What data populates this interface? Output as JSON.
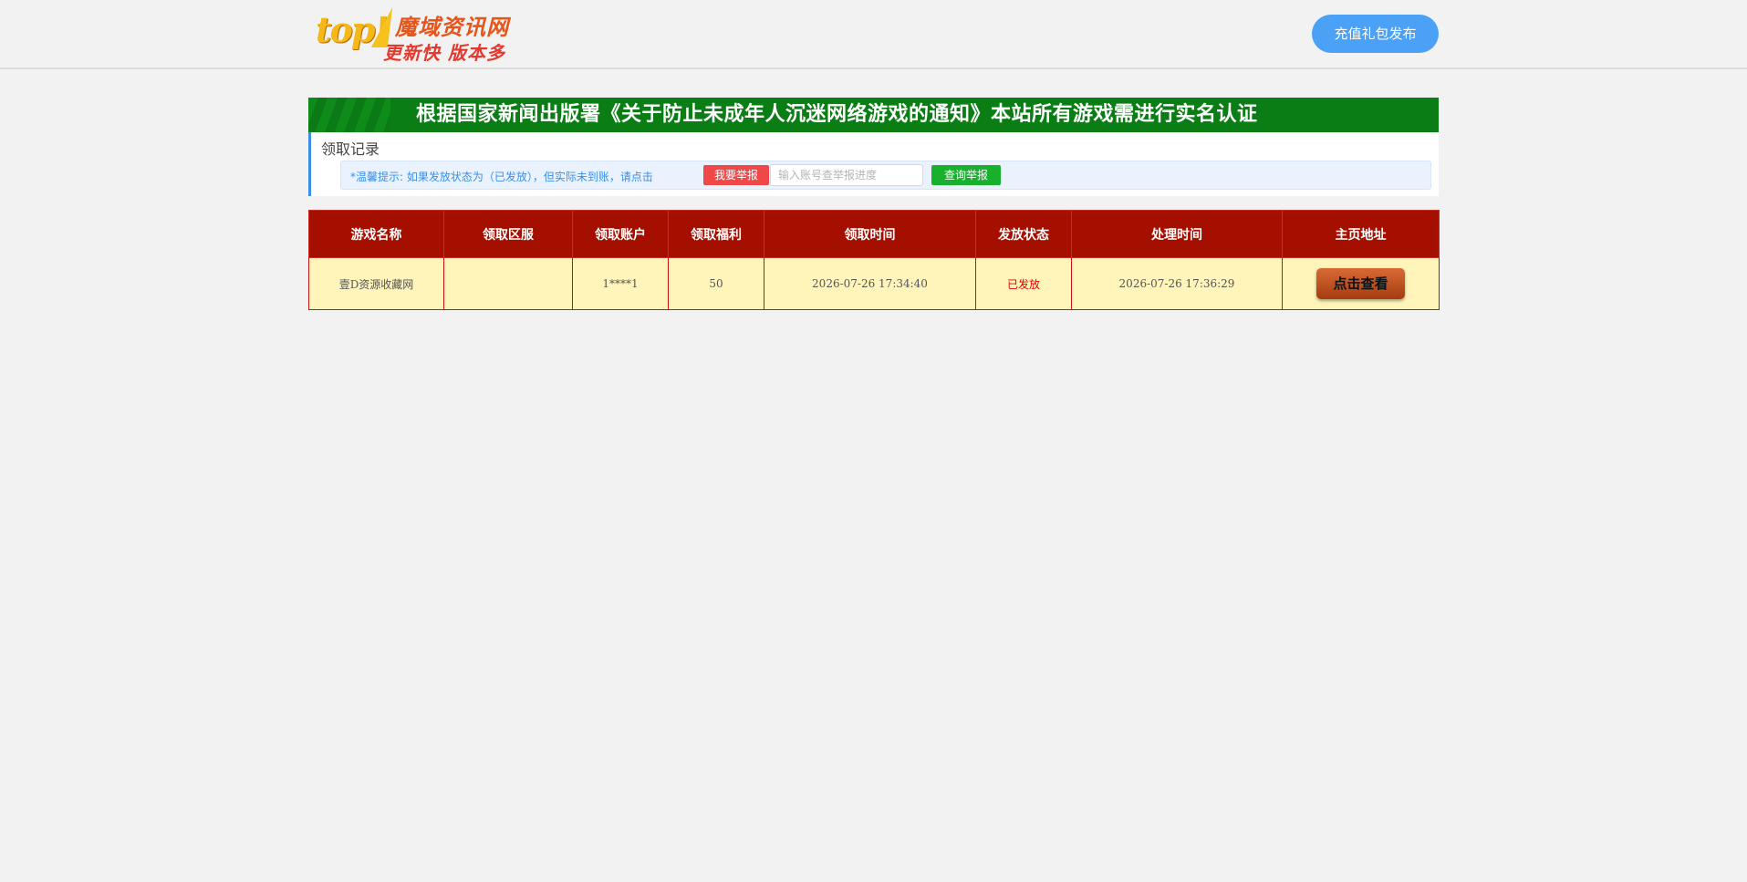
{
  "header": {
    "logo": {
      "top_text": "top!",
      "site_name": "魔域资讯网",
      "slogan": "更新快 版本多"
    },
    "publish_button": "充值礼包发布"
  },
  "notice": {
    "text": "根据国家新闻出版署《关于防止未成年人沉迷网络游戏的通知》本站所有游戏需进行实名认证"
  },
  "records": {
    "title": "领取记录",
    "tip": "*温馨提示: 如果发放状态为（已发放），但实际未到账，请点击",
    "report_button": "我要举报",
    "search_placeholder": "输入账号查举报进度",
    "query_button": "查询举报"
  },
  "table": {
    "headers": [
      "游戏名称",
      "领取区服",
      "领取账户",
      "领取福利",
      "领取时间",
      "发放状态",
      "处理时间",
      "主页地址"
    ],
    "rows": [
      {
        "game": "壹D资源收藏网",
        "server": "",
        "account": "1****1",
        "benefit": "50",
        "claim_time": "2026-07-26 17:34:40",
        "status": "已发放",
        "process_time": "2026-07-26 17:36:29",
        "action": "点击查看"
      }
    ]
  },
  "colors": {
    "accent_blue": "#4aa1f5",
    "banner_green": "#0a7d14",
    "table_header_red": "#a40f00",
    "row_bg": "#fff5ba",
    "status_red": "#e00000"
  }
}
